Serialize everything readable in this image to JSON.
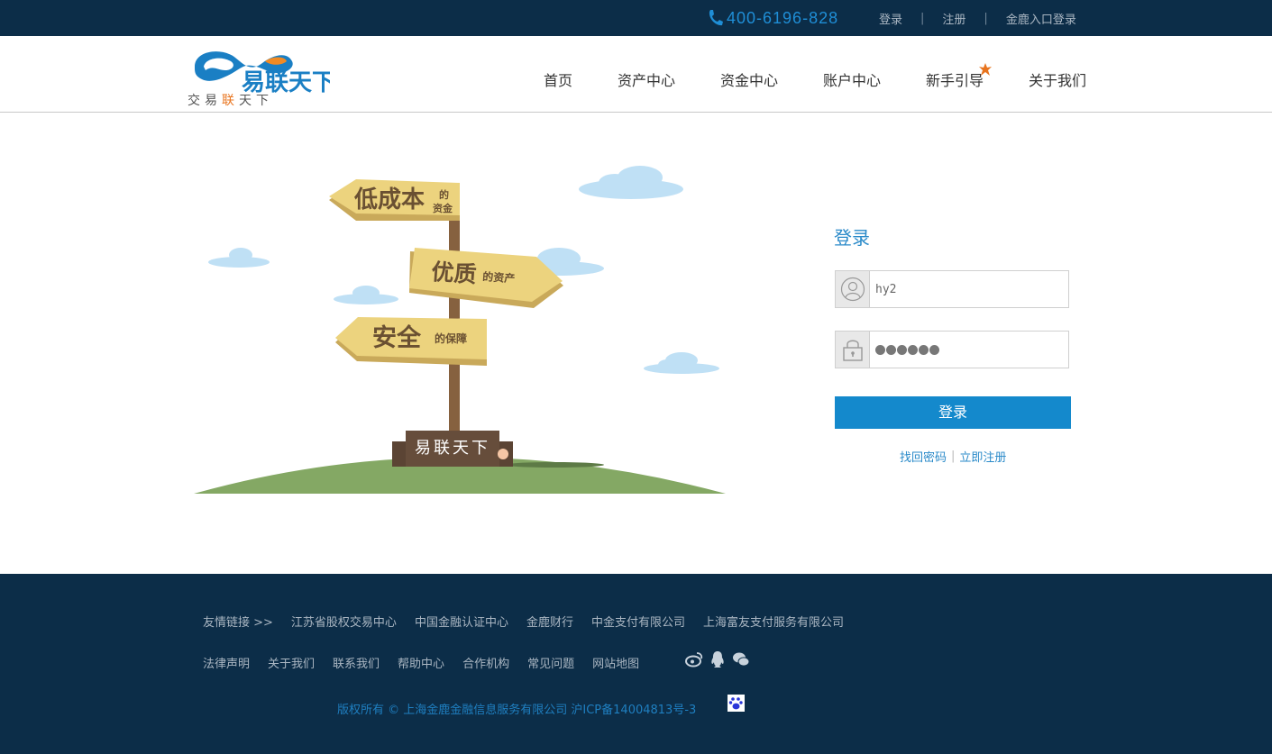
{
  "topbar": {
    "phone": "400-6196-828",
    "links": [
      "登录",
      "注册",
      "金鹿入口登录"
    ]
  },
  "header": {
    "logo_slogan_a": "交易",
    "logo_slogan_b": "联",
    "logo_slogan_c": "天下",
    "nav": [
      "首页",
      "资产中心",
      "资金中心",
      "账户中心",
      "新手引导",
      "关于我们"
    ]
  },
  "illustration": {
    "sign1_main": "低成本",
    "sign1_sub1": "的",
    "sign1_sub2": "资金",
    "sign2_main": "优质",
    "sign2_sub": "的资产",
    "sign3_main": "安全",
    "sign3_sub": "的保障",
    "base_label": "易联天下"
  },
  "login": {
    "title": "登录",
    "username_value": "hy2",
    "password_dots": 6,
    "submit_label": "登录",
    "forgot_label": "找回密码",
    "register_label": "立即注册"
  },
  "footer": {
    "friend_links_label": "友情链接 >>",
    "friend_links": [
      "江苏省股权交易中心",
      "中国金融认证中心",
      "金鹿财行",
      "中金支付有限公司",
      "上海富友支付服务有限公司"
    ],
    "bottom_links": [
      "法律声明",
      "关于我们",
      "联系我们",
      "帮助中心",
      "合作机构",
      "常见问题",
      "网站地图"
    ],
    "copyright": "版权所有 © 上海金鹿金融信息服务有限公司 沪ICP备14004813号-3"
  },
  "colors": {
    "dark_navy": "#0c2d48",
    "accent_blue": "#1489cc",
    "sign_yellow": "#ecd37e",
    "grass": "#84a864"
  }
}
